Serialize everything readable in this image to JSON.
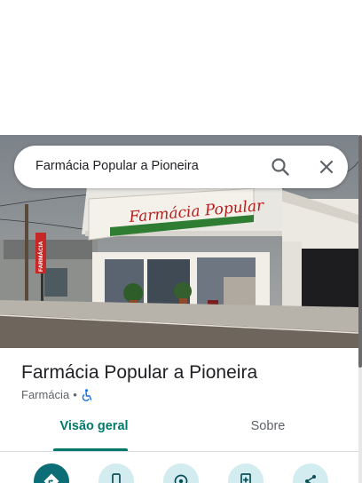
{
  "search": {
    "query": "Farmácia Popular a Pioneira"
  },
  "storefront": {
    "sign_text": "Farmácia Popular",
    "pole_sign": "FARMÁCIA"
  },
  "place": {
    "name": "Farmácia Popular a Pioneira",
    "category": "Farmácia",
    "separator": "•"
  },
  "tabs": [
    {
      "label": "Visão geral",
      "active": true
    },
    {
      "label": "Sobre",
      "active": false
    }
  ],
  "actions": [
    {
      "icon": "directions-icon",
      "primary": true
    },
    {
      "icon": "phone-icon"
    },
    {
      "icon": "start-navigation-icon"
    },
    {
      "icon": "save-icon"
    },
    {
      "icon": "share-icon"
    }
  ],
  "colors": {
    "accent": "#00796b",
    "action_bg": "#d2ecf0",
    "primary_action": "#0b6d75",
    "sign_red": "#c62828"
  }
}
